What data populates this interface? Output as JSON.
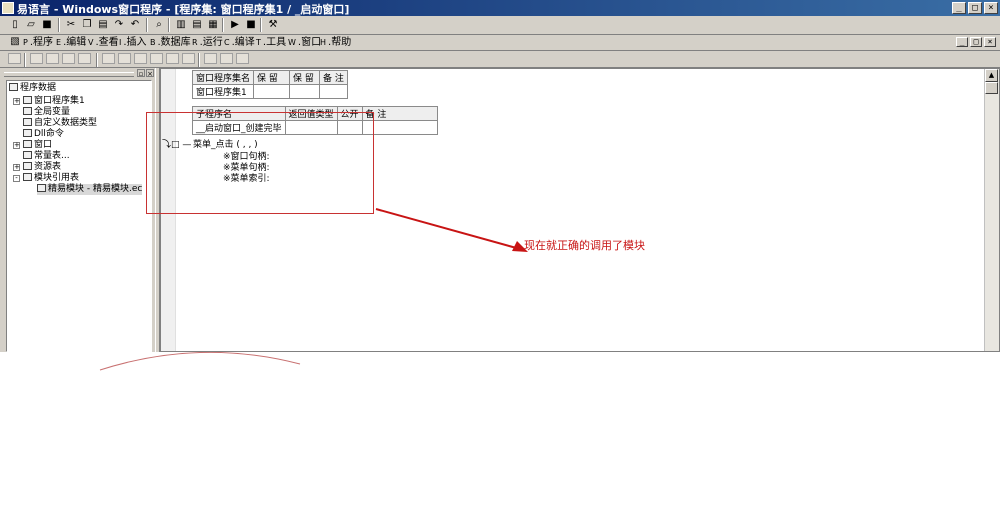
{
  "window": {
    "title": "易语言 - Windows窗口程序 - [程序集: 窗口程序集1 / _启动窗口]",
    "controls": [
      "_",
      "□",
      "×"
    ]
  },
  "mdi_controls": [
    "_",
    "□",
    "×"
  ],
  "menu": [
    {
      "hotkey": "P",
      "label": ".程序"
    },
    {
      "hotkey": "E",
      "label": ".编辑"
    },
    {
      "hotkey": "V",
      "label": ".查看"
    },
    {
      "hotkey": "I",
      "label": ".插入"
    },
    {
      "hotkey": "B",
      "label": ".数据库"
    },
    {
      "hotkey": "R",
      "label": ".运行"
    },
    {
      "hotkey": "C",
      "label": ".编译"
    },
    {
      "hotkey": "T",
      "label": ".工具"
    },
    {
      "hotkey": "W",
      "label": ".窗口"
    },
    {
      "hotkey": "H",
      "label": ".帮助"
    }
  ],
  "tree": {
    "root": "程序数据",
    "items": [
      "窗口程序集1",
      "全局变量",
      "自定义数据类型",
      "Dll命令",
      "窗口",
      "常量表...",
      "资源表",
      "模块引用表",
      "精易模块 - 精易模块.ec"
    ],
    "expanders": [
      "+",
      "",
      "",
      "",
      "+",
      "",
      "+",
      "-",
      ""
    ]
  },
  "assembly_table": {
    "headers": [
      "窗口程序集名",
      "保 留",
      "保 留",
      "备 注"
    ],
    "row": [
      "窗口程序集1",
      "",
      "",
      ""
    ]
  },
  "sub_table": {
    "headers": [
      "子程序名",
      "返回值类型",
      "公开",
      "备 注"
    ],
    "row": [
      "__启动窗口_创建完毕",
      "",
      "",
      ""
    ]
  },
  "code": {
    "marker": "⤵□ —",
    "call": "菜单_点击 ( , , )",
    "params": [
      "※窗口句柄:",
      "※菜单句柄:",
      "※菜单索引:"
    ]
  },
  "annotation": "现在就正确的调用了模块",
  "colors": {
    "title_start": "#0a246a",
    "title_end": "#3a6ea5",
    "annotation": "#c81414",
    "chrome": "#d4d0c8"
  }
}
